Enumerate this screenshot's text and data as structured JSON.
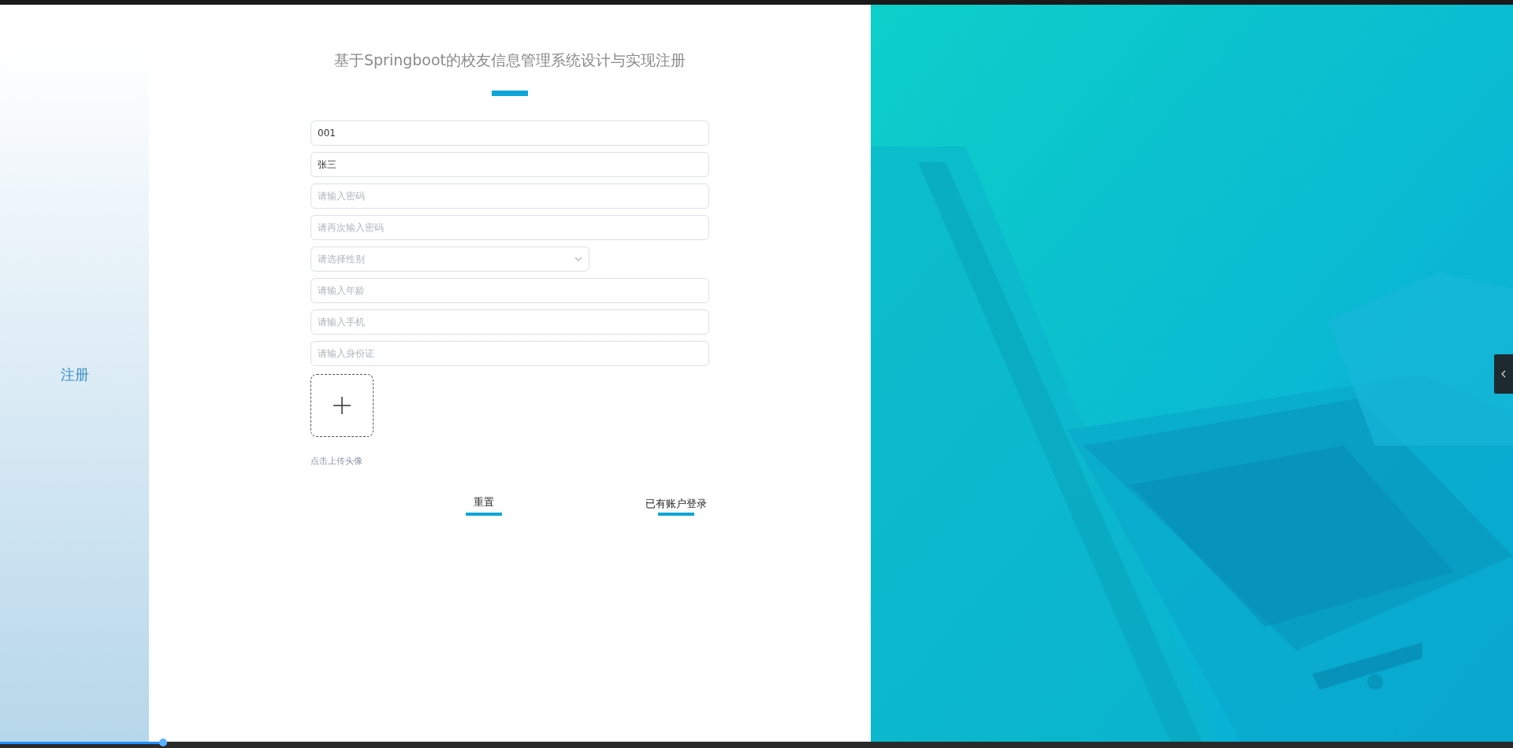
{
  "side_label": "注册",
  "title": "基于Springboot的校友信息管理系统设计与实现注册",
  "fields": [
    {
      "kind": "input",
      "value": "001"
    },
    {
      "kind": "input",
      "value": "张三"
    },
    {
      "kind": "input",
      "placeholder": "请输入密码"
    },
    {
      "kind": "input",
      "placeholder": "请再次输入密码"
    },
    {
      "kind": "select",
      "placeholder": "请选择性别"
    },
    {
      "kind": "input",
      "placeholder": "请输入年龄"
    },
    {
      "kind": "input",
      "placeholder": "请输入手机"
    },
    {
      "kind": "input",
      "placeholder": "请输入身份证"
    }
  ],
  "upload": {
    "hint": "点击上传头像"
  },
  "buttons": [
    "重置",
    "已有账户登录"
  ],
  "player": {
    "level": 0.108
  }
}
